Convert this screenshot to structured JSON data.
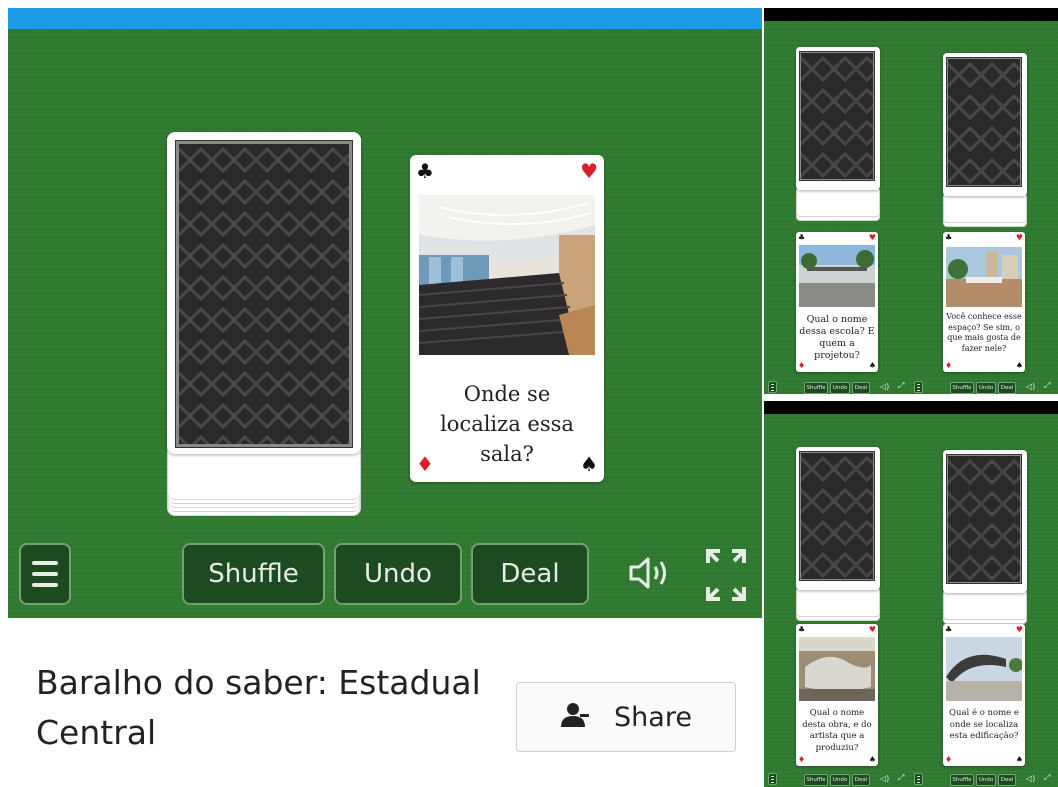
{
  "app": {
    "accent_color": "#1e9be8",
    "felt_color": "#2f7a30"
  },
  "main_game": {
    "face_card": {
      "question": "Onde se localiza essa sala?",
      "photo": "auditorium-photo",
      "suit_top_left": "♣",
      "suit_top_right": "♥",
      "suit_bottom_left": "♦",
      "suit_bottom_right": "♠"
    },
    "controls": {
      "menu_icon": "hamburger-icon",
      "shuffle": "Shuffle",
      "undo": "Undo",
      "deal": "Deal",
      "sound_icon": "speaker-icon",
      "fullscreen_icon": "expand-icon"
    }
  },
  "info": {
    "title": "Baralho do saber: Estadual Central",
    "share_label": "Share",
    "share_icon": "person-icon"
  },
  "thumbnails": [
    {
      "cards": [
        {
          "question": "Qual o nome dessa escola? E quem a projetou?",
          "photo": "school-building-photo"
        },
        {
          "question": "Você conhece esse espaço? Se sim, o que mais gosta de fazer nele?",
          "photo": "courtyard-photo"
        }
      ],
      "controls": {
        "shuffle": "Shuffle",
        "undo": "Undo",
        "deal": "Deal"
      }
    },
    {
      "cards": [
        {
          "question": "Qual o nome desta obra, e do artista que a produziu?",
          "photo": "sculpture-photo"
        },
        {
          "question": "Qual é o nome e onde se localiza esta edificação?",
          "photo": "curved-building-photo"
        }
      ],
      "controls": {
        "shuffle": "Shuffle",
        "undo": "Undo",
        "deal": "Deal"
      }
    }
  ]
}
